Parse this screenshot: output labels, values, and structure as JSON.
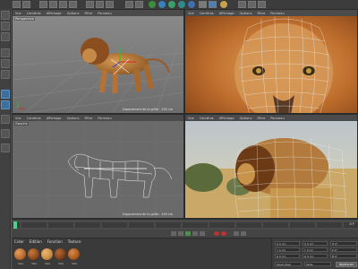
{
  "viewports": {
    "top_left": {
      "name": "Perspective",
      "menu": [
        "Vue",
        "Caméras",
        "Affichage",
        "Options",
        "Filtre",
        "Panneau"
      ],
      "grid_info": "Espacement de la grille : 100 cm"
    },
    "top_right": {
      "menu": [
        "Vue",
        "Caméras",
        "Affichage",
        "Options",
        "Filtre",
        "Panneau"
      ]
    },
    "bottom_left": {
      "name": "Gauche",
      "menu": [
        "Vue",
        "Caméras",
        "Affichage",
        "Options",
        "Filtre",
        "Panneau"
      ],
      "grid_info": "Espacement de la grille : 100 cm"
    },
    "bottom_right": {
      "menu": [
        "Vue",
        "Caméras",
        "Affichage",
        "Options",
        "Filtre",
        "Panneau"
      ]
    }
  },
  "timeline": {
    "frame": "0 F"
  },
  "materials": {
    "menu": [
      "Créer",
      "Edition",
      "Fonction",
      "Texture"
    ],
    "swatches": [
      {
        "label": "Mat",
        "color": "#b8682a"
      },
      {
        "label": "Mat",
        "color": "#8c4a1c"
      },
      {
        "label": "Mat",
        "color": "#c98b45"
      },
      {
        "label": "Mat",
        "color": "#7a3e18"
      },
      {
        "label": "Mat",
        "color": "#a95a20"
      }
    ]
  },
  "coordinates": {
    "rows": [
      {
        "a": "X 0 cm",
        "b": "X 0 cm",
        "c": "H 0°"
      },
      {
        "a": "Y 0 cm",
        "b": "Y 0 cm",
        "c": "P 0°"
      },
      {
        "a": "Z 0 cm",
        "b": "Z 0 cm",
        "c": "B 0°"
      }
    ],
    "mode": "Objet (Rel)",
    "size_mode": "Taille",
    "apply_label": "Appliquer"
  },
  "colors": {
    "accent": "#3d6f9e",
    "bg": "#5a5a5a"
  }
}
